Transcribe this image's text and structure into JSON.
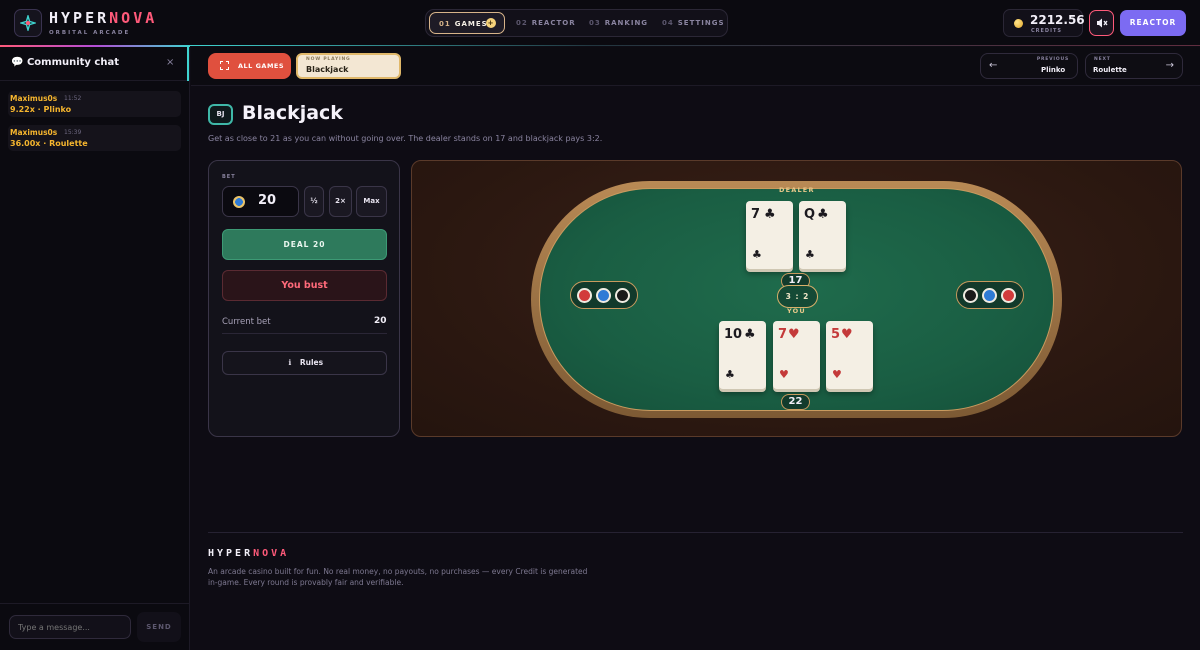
{
  "header": {
    "brand_main": "HYPER",
    "brand_accent": "NOVA",
    "brand_sub": "ORBITAL ARCADE",
    "nav": [
      {
        "num": "01",
        "label": "GAMES"
      },
      {
        "num": "02",
        "label": "REACTOR"
      },
      {
        "num": "03",
        "label": "RANKING"
      },
      {
        "num": "04",
        "label": "SETTINGS"
      }
    ],
    "nav_badge": "+",
    "credits_value": "2212.56",
    "credits_label": "CREDITS",
    "mute_icon": "speaker-muted-icon",
    "reactor_button": "REACTOR"
  },
  "sidebar": {
    "title": "Community chat",
    "close": "×",
    "messages": [
      {
        "user": "Maximus0s",
        "time": "11:52",
        "text": "9.22x · Plinko"
      },
      {
        "user": "Maximus0s",
        "time": "15:39",
        "text": "36.00x · Roulette"
      }
    ],
    "input_placeholder": "Type a message...",
    "send_label": "SEND"
  },
  "subbar": {
    "all_games": "ALL GAMES",
    "now_playing_label": "NOW PLAYING",
    "now_playing_value": "Blackjack",
    "previous_label": "PREVIOUS",
    "previous_value": "Plinko",
    "next_label": "NEXT",
    "next_value": "Roulette",
    "prev_arrow": "←",
    "next_arrow": "→"
  },
  "game": {
    "code": "BJ",
    "title": "Blackjack",
    "description": "Get as close to 21 as you can without going over. The dealer stands on 17 and blackjack pays 3:2."
  },
  "bet_panel": {
    "label": "BET",
    "value": "20",
    "half": "½",
    "double": "2×",
    "max": "Max",
    "deal_button": "DEAL 20",
    "result": "You bust",
    "current_bet_label": "Current bet",
    "current_bet_value": "20",
    "rules_icon": "ℹ",
    "rules_button": "Rules"
  },
  "table": {
    "dealer_label": "DEALER",
    "you_label": "YOU",
    "payout": "3 : 2",
    "dealer_cards": [
      {
        "rank": "7",
        "suit": "♣",
        "color": "black"
      },
      {
        "rank": "Q",
        "suit": "♣",
        "color": "black"
      }
    ],
    "dealer_score": "17",
    "player_cards": [
      {
        "rank": "10",
        "suit": "♣",
        "color": "black"
      },
      {
        "rank": "7",
        "suit": "♥",
        "color": "red"
      },
      {
        "rank": "5",
        "suit": "♥",
        "color": "red"
      }
    ],
    "player_score": "22",
    "chip_colors_left": [
      "#d23b3b",
      "#2f7bd6",
      "#1a1a1a"
    ],
    "chip_colors_right": [
      "#1a1a1a",
      "#2f7bd6",
      "#d23b3b"
    ]
  },
  "footer": {
    "brand_main": "HYPER",
    "brand_accent": "NOVA",
    "text": "An arcade casino built for fun. No real money, no payouts, no purchases — every Credit is generated in-game. Every round is provably fair and verifiable."
  },
  "colors": {
    "accent_pink": "#ff5a7a",
    "accent_teal": "#3fd4d0",
    "accent_violet": "#7c6bf2",
    "gold": "#f5b52e",
    "felt_green": "#1a5e43"
  }
}
